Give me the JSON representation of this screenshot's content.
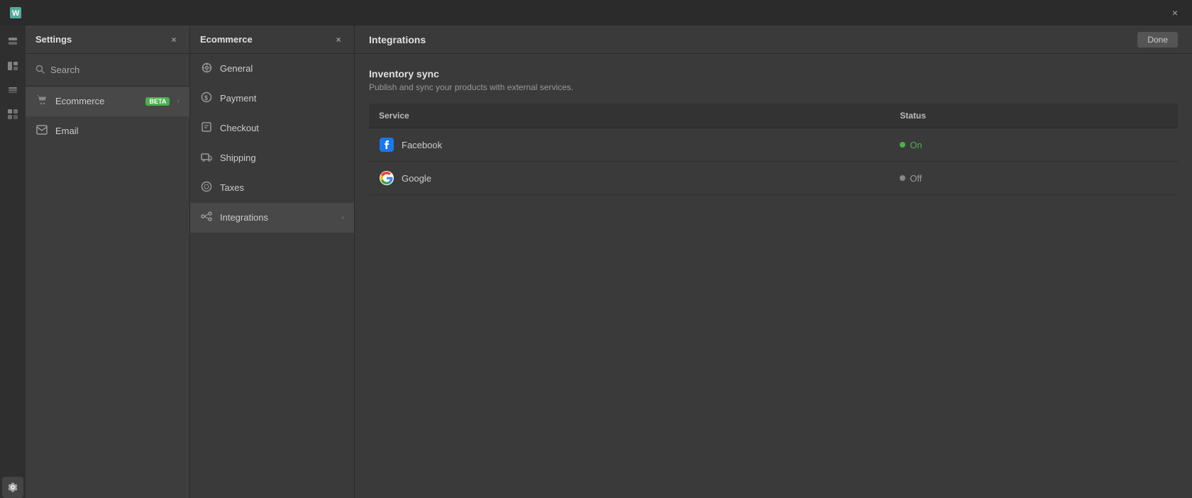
{
  "titleBar": {
    "closeLabel": "×"
  },
  "iconSidebar": {
    "items": [
      {
        "name": "pages-icon",
        "icon": "⬜",
        "active": false
      },
      {
        "name": "sections-icon",
        "icon": "☰",
        "active": false
      },
      {
        "name": "layers-icon",
        "icon": "◫",
        "active": false
      },
      {
        "name": "components-icon",
        "icon": "◱",
        "active": false
      },
      {
        "name": "apps-icon",
        "icon": "⬡",
        "active": false
      },
      {
        "name": "settings-icon",
        "icon": "⚙",
        "active": true
      }
    ]
  },
  "settingsPanel": {
    "title": "Settings",
    "closeLabel": "×",
    "search": {
      "placeholder": "Search",
      "label": "Search"
    },
    "navItems": [
      {
        "id": "ecommerce",
        "label": "Ecommerce",
        "badge": "BETA",
        "hasBadge": true,
        "hasChevron": true,
        "active": true,
        "icon": "🛒"
      },
      {
        "id": "email",
        "label": "Email",
        "hasBadge": false,
        "hasChevron": false,
        "active": false,
        "icon": "✉"
      }
    ]
  },
  "ecommercePanel": {
    "title": "Ecommerce",
    "closeLabel": "×",
    "navItems": [
      {
        "id": "general",
        "label": "General",
        "icon": "⚙",
        "active": false
      },
      {
        "id": "payment",
        "label": "Payment",
        "icon": "$",
        "active": false
      },
      {
        "id": "checkout",
        "label": "Checkout",
        "icon": "🏷",
        "active": false
      },
      {
        "id": "shipping",
        "label": "Shipping",
        "icon": "📦",
        "active": false
      },
      {
        "id": "taxes",
        "label": "Taxes",
        "icon": "◎",
        "active": false
      },
      {
        "id": "integrations",
        "label": "Integrations",
        "icon": "🔗",
        "active": true,
        "hasChevron": true
      }
    ]
  },
  "mainContent": {
    "title": "Integrations",
    "doneLabel": "Done",
    "section": {
      "title": "Inventory sync",
      "subtitle": "Publish and sync your products with external services."
    },
    "table": {
      "columns": [
        "Service",
        "Status"
      ],
      "rows": [
        {
          "service": "Facebook",
          "serviceIcon": "facebook",
          "status": "On",
          "statusType": "on"
        },
        {
          "service": "Google",
          "serviceIcon": "google",
          "status": "Off",
          "statusType": "off"
        }
      ]
    }
  }
}
